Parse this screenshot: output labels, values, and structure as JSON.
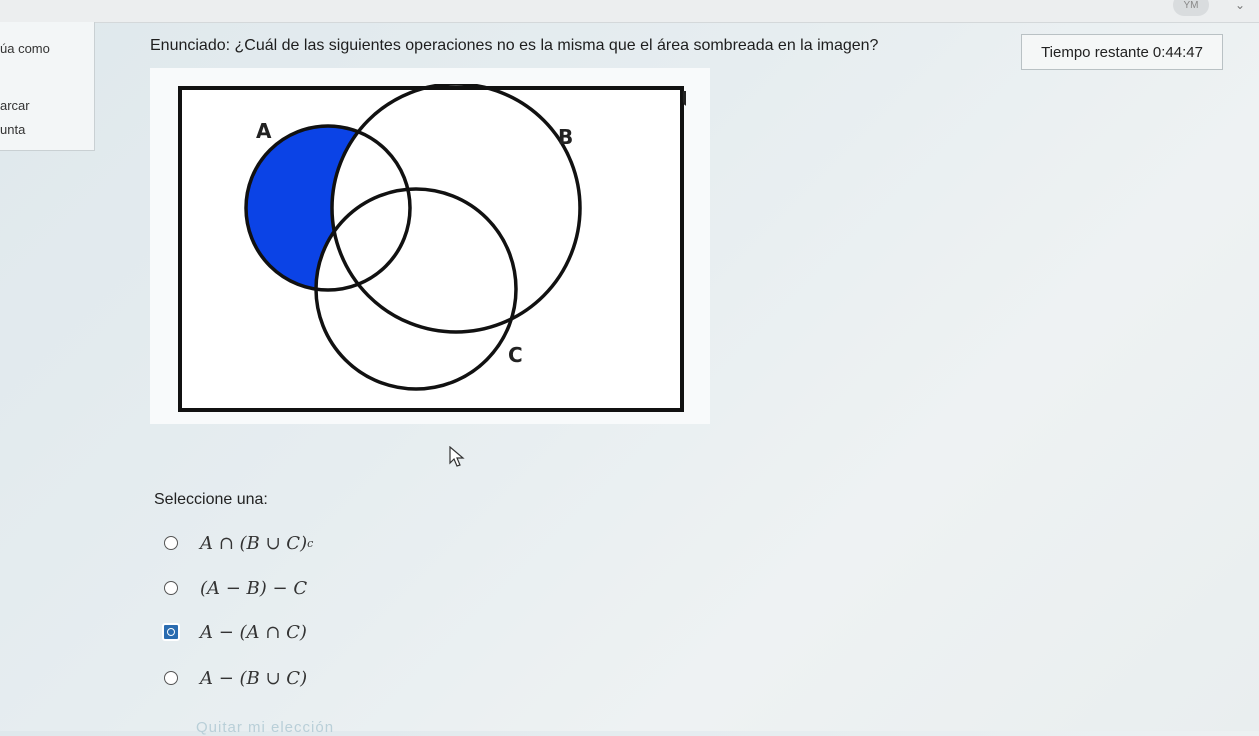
{
  "sidebar": {
    "items": [
      "úa como",
      "arcar",
      "unta"
    ]
  },
  "question": {
    "prefix": "Enunciado:",
    "text": "¿Cuál de las siguientes operaciones no es la misma que el área sombreada en la imagen?"
  },
  "timer": {
    "label": "Tiempo restante",
    "value": "0:44:47"
  },
  "venn": {
    "universe_label": "U",
    "set_a_label": "A",
    "set_b_label": "B",
    "set_c_label": "C",
    "shade_color": "#0b43e6"
  },
  "answers": {
    "prompt": "Seleccione una:",
    "options": [
      {
        "text": "A ∩ (B ∪ C)",
        "sup": "c",
        "selected": false
      },
      {
        "text": "(A − B) − C",
        "sup": "",
        "selected": false
      },
      {
        "text": "A − (A ∩ C)",
        "sup": "",
        "selected": true
      },
      {
        "text": "A − (B ∪ C)",
        "sup": "",
        "selected": false
      }
    ],
    "clear_label": "Quitar mi elección"
  },
  "topbar": {
    "user_initials": "YM"
  }
}
